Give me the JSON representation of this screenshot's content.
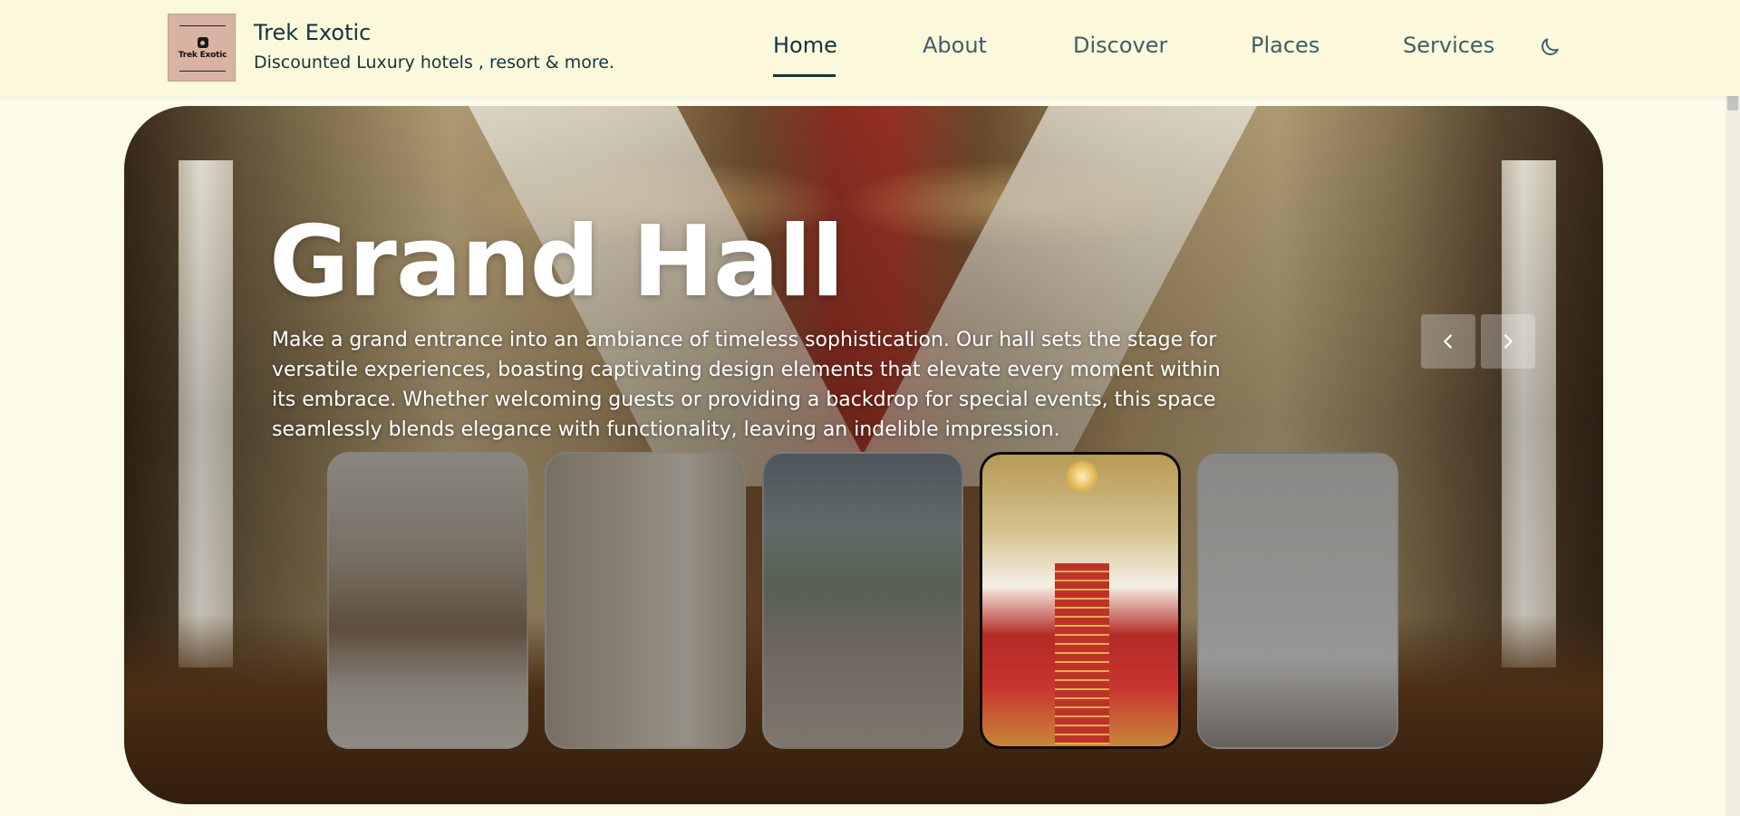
{
  "brand": {
    "logo_text": "Trek Exotic",
    "title": "Trek Exotic",
    "subtitle": "Discounted Luxury hotels , resort & more."
  },
  "nav": {
    "items": [
      {
        "label": "Home",
        "active": true
      },
      {
        "label": "About",
        "active": false
      },
      {
        "label": "Discover",
        "active": false
      },
      {
        "label": "Places",
        "active": false
      },
      {
        "label": "Services",
        "active": false
      }
    ],
    "theme_toggle_icon": "moon-icon"
  },
  "hero": {
    "title": "Grand Hall",
    "description": "Make a grand entrance into an ambiance of timeless sophistication. Our hall sets the stage for versatile experiences, boasting captivating design elements that elevate every moment within its embrace. Whether welcoming guests or providing a backdrop for special events, this space seamlessly blends elegance with functionality, leaving an indelible impression.",
    "prev_icon": "chevron-left-icon",
    "next_icon": "chevron-right-icon"
  },
  "thumbnails": [
    {
      "name": "lounge",
      "active": false
    },
    {
      "name": "living-room",
      "active": false
    },
    {
      "name": "dining-hall",
      "active": false
    },
    {
      "name": "grand-hall",
      "active": true
    },
    {
      "name": "bedroom",
      "active": false
    }
  ],
  "colors": {
    "page_bg": "#fcfbe9",
    "header_bg": "#fbf8dc",
    "text_dark": "#12343f",
    "nav_text": "#3f5e68",
    "logo_bg": "#d8b3a4"
  }
}
